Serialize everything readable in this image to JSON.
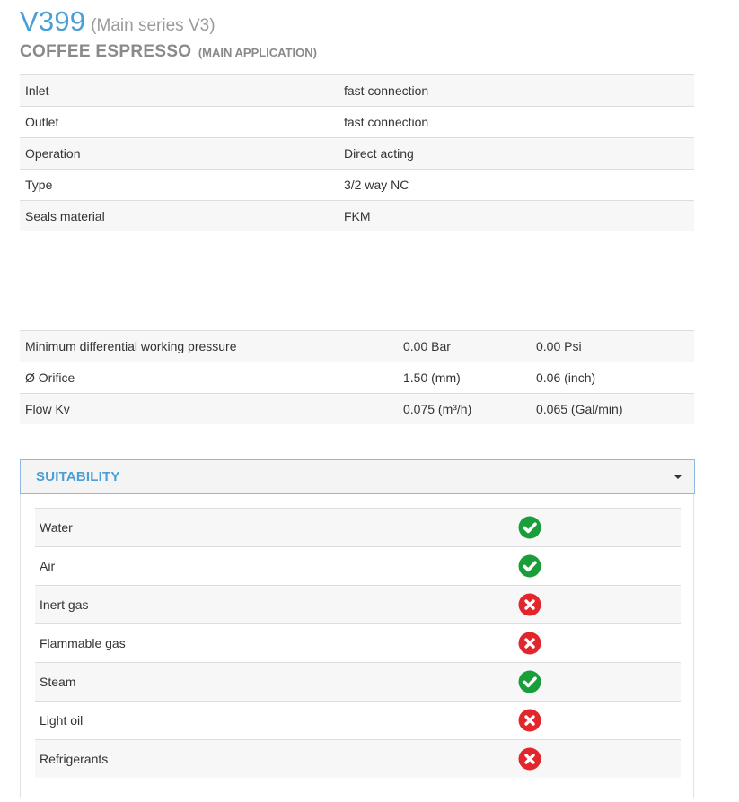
{
  "header": {
    "model": "V399",
    "series": "(Main series V3)",
    "application": "COFFEE ESPRESSO",
    "application_note": "(MAIN APPLICATION)"
  },
  "specs": [
    {
      "label": "Inlet",
      "value": "fast connection"
    },
    {
      "label": "Outlet",
      "value": "fast connection"
    },
    {
      "label": "Operation",
      "value": "Direct acting"
    },
    {
      "label": "Type",
      "value": "3/2 way NC"
    },
    {
      "label": "Seals material",
      "value": "FKM"
    }
  ],
  "performance": [
    {
      "label": "Minimum differential working pressure",
      "metric": "0.00 Bar",
      "imperial": "0.00 Psi"
    },
    {
      "label": "Ø Orifice",
      "metric": "1.50 (mm)",
      "imperial": "0.06 (inch)"
    },
    {
      "label": "Flow Kv",
      "metric": "0.075 (m³/h)",
      "imperial": "0.065 (Gal/min)"
    }
  ],
  "suitability": {
    "title": "SUITABILITY",
    "items": [
      {
        "name": "Water",
        "suitable": true,
        "icon": "check-circle-icon"
      },
      {
        "name": "Air",
        "suitable": true,
        "icon": "check-circle-icon"
      },
      {
        "name": "Inert gas",
        "suitable": false,
        "icon": "x-circle-icon"
      },
      {
        "name": "Flammable gas",
        "suitable": false,
        "icon": "x-circle-icon"
      },
      {
        "name": "Steam",
        "suitable": true,
        "icon": "check-circle-icon"
      },
      {
        "name": "Light oil",
        "suitable": false,
        "icon": "x-circle-icon"
      },
      {
        "name": "Refrigerants",
        "suitable": false,
        "icon": "x-circle-icon"
      }
    ]
  },
  "colors": {
    "accent": "#4a9fd5",
    "ok": "#1a9e3a",
    "no": "#e3262b"
  }
}
